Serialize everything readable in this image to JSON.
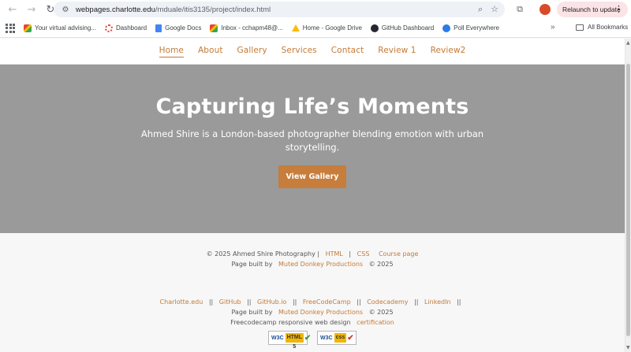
{
  "browser": {
    "url_host": "webpages.charlotte.edu",
    "url_path": "/mduale/itis3135/project/index.html",
    "relaunch_label": "Relaunch to update",
    "bookmarks": [
      {
        "label": "Your virtual advising...",
        "icon": "gmail-icon"
      },
      {
        "label": "Dashboard",
        "icon": "canvas-icon"
      },
      {
        "label": "Google Docs",
        "icon": "google-docs-icon"
      },
      {
        "label": "Inbox - cchapm48@...",
        "icon": "gmail-icon"
      },
      {
        "label": "Home - Google Drive",
        "icon": "google-drive-icon"
      },
      {
        "label": "GitHub Dashboard",
        "icon": "github-icon"
      },
      {
        "label": "Poll Everywhere",
        "icon": "poll-everywhere-icon"
      }
    ],
    "more_bookmarks": "»",
    "all_bookmarks": "All Bookmarks"
  },
  "nav": {
    "items": [
      "Home",
      "About",
      "Gallery",
      "Services",
      "Contact",
      "Review 1",
      "Review2"
    ],
    "active": "Home"
  },
  "hero": {
    "title": "Capturing Life’s Moments",
    "subtitle": "Ahmed Shire is a London-based photographer blending emotion with urban storytelling.",
    "button": "View Gallery",
    "bg_color": "#9a9a9a",
    "button_color": "#c77d3b"
  },
  "footer1": {
    "copyright": "© 2025 Ahmed Shire Photography |",
    "html_link": "HTML",
    "sep": "|",
    "css_link": "CSS",
    "course_link": "Course page",
    "built_by": "Page built by",
    "maker_link": "Muted Donkey Productions",
    "year": "© 2025"
  },
  "footer2": {
    "links": [
      "Charlotte.edu",
      "GitHub",
      "GitHub.io",
      "FreeCodeCamp",
      "Codecademy",
      "LinkedIn"
    ],
    "sep": "||",
    "built_by": "Page built by",
    "maker_link": "Muted Donkey Productions",
    "year": "© 2025",
    "fcc_text": "Freecodecamp responsive web design",
    "cert_link": "certification",
    "badge_html": {
      "w3c": "W3C",
      "tag": "HTML 5"
    },
    "badge_css": {
      "w3c": "W3C",
      "tag": "css"
    }
  },
  "colors": {
    "accent": "#c47a36"
  }
}
